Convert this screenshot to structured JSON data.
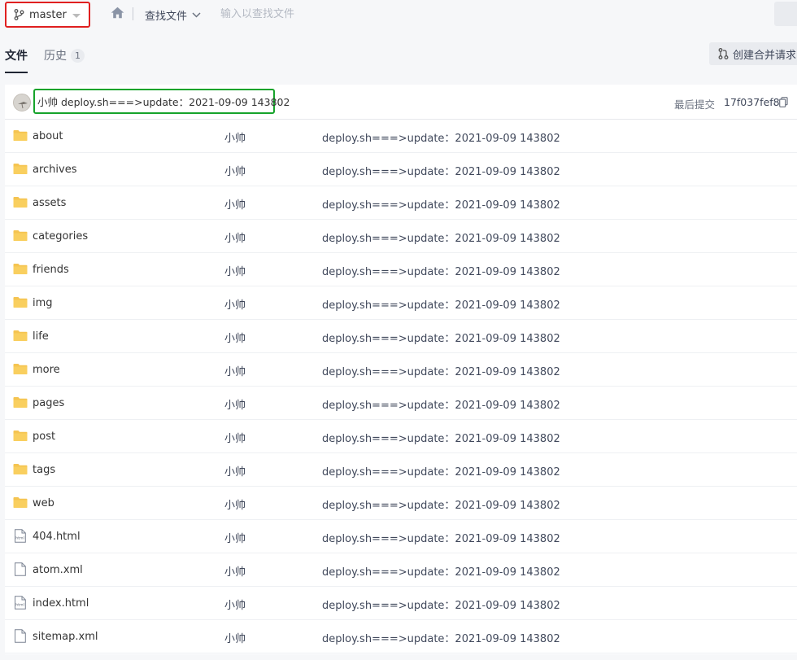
{
  "toolbar": {
    "branch": "master",
    "find_file": "查找文件",
    "search_placeholder": "输入以查找文件"
  },
  "tabs": {
    "files": "文件",
    "history": "历史",
    "history_count": "1"
  },
  "merge_request_button": "创建合并请求",
  "last_commit": {
    "message": "小帅 deploy.sh===>update：2021-09-09 143802",
    "label": "最后提交",
    "hash": "17f037fef8"
  },
  "files": [
    {
      "name": "about",
      "type": "folder",
      "author": "小帅",
      "message": "deploy.sh===>update：2021-09-09 143802"
    },
    {
      "name": "archives",
      "type": "folder",
      "author": "小帅",
      "message": "deploy.sh===>update：2021-09-09 143802"
    },
    {
      "name": "assets",
      "type": "folder",
      "author": "小帅",
      "message": "deploy.sh===>update：2021-09-09 143802"
    },
    {
      "name": "categories",
      "type": "folder",
      "author": "小帅",
      "message": "deploy.sh===>update：2021-09-09 143802"
    },
    {
      "name": "friends",
      "type": "folder",
      "author": "小帅",
      "message": "deploy.sh===>update：2021-09-09 143802"
    },
    {
      "name": "img",
      "type": "folder",
      "author": "小帅",
      "message": "deploy.sh===>update：2021-09-09 143802"
    },
    {
      "name": "life",
      "type": "folder",
      "author": "小帅",
      "message": "deploy.sh===>update：2021-09-09 143802"
    },
    {
      "name": "more",
      "type": "folder",
      "author": "小帅",
      "message": "deploy.sh===>update：2021-09-09 143802"
    },
    {
      "name": "pages",
      "type": "folder",
      "author": "小帅",
      "message": "deploy.sh===>update：2021-09-09 143802"
    },
    {
      "name": "post",
      "type": "folder",
      "author": "小帅",
      "message": "deploy.sh===>update：2021-09-09 143802"
    },
    {
      "name": "tags",
      "type": "folder",
      "author": "小帅",
      "message": "deploy.sh===>update：2021-09-09 143802"
    },
    {
      "name": "web",
      "type": "folder",
      "author": "小帅",
      "message": "deploy.sh===>update：2021-09-09 143802"
    },
    {
      "name": "404.html",
      "type": "html",
      "author": "小帅",
      "message": "deploy.sh===>update：2021-09-09 143802"
    },
    {
      "name": "atom.xml",
      "type": "file",
      "author": "小帅",
      "message": "deploy.sh===>update：2021-09-09 143802"
    },
    {
      "name": "index.html",
      "type": "html",
      "author": "小帅",
      "message": "deploy.sh===>update：2021-09-09 143802"
    },
    {
      "name": "sitemap.xml",
      "type": "file",
      "author": "小帅",
      "message": "deploy.sh===>update：2021-09-09 143802"
    }
  ],
  "icons": {
    "branch": "git-branch-icon",
    "home": "home-icon",
    "folder": "folder-icon",
    "html": "html-file-icon",
    "file": "file-icon",
    "merge": "merge-request-icon",
    "copy": "copy-icon"
  },
  "colors": {
    "folder": "#f5c451",
    "branch_highlight": "#e02020",
    "commit_highlight": "#16a32b"
  }
}
